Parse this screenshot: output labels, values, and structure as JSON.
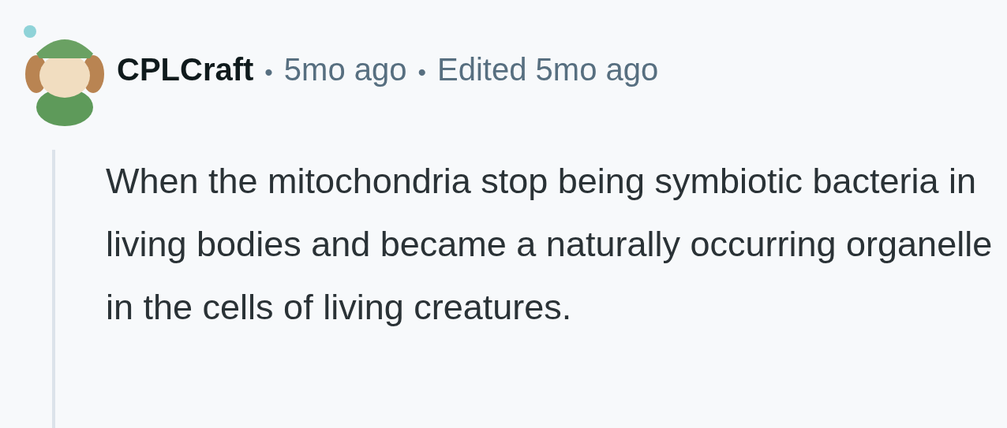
{
  "comment": {
    "author": "CPLCraft",
    "separator_1": "•",
    "age": "5mo ago",
    "separator_2": "•",
    "edited": "Edited 5mo ago",
    "body": "When the mitochondria stop being symbiotic bacteria in living bodies and became a naturally occurring organelle in the cells of living creatures."
  }
}
